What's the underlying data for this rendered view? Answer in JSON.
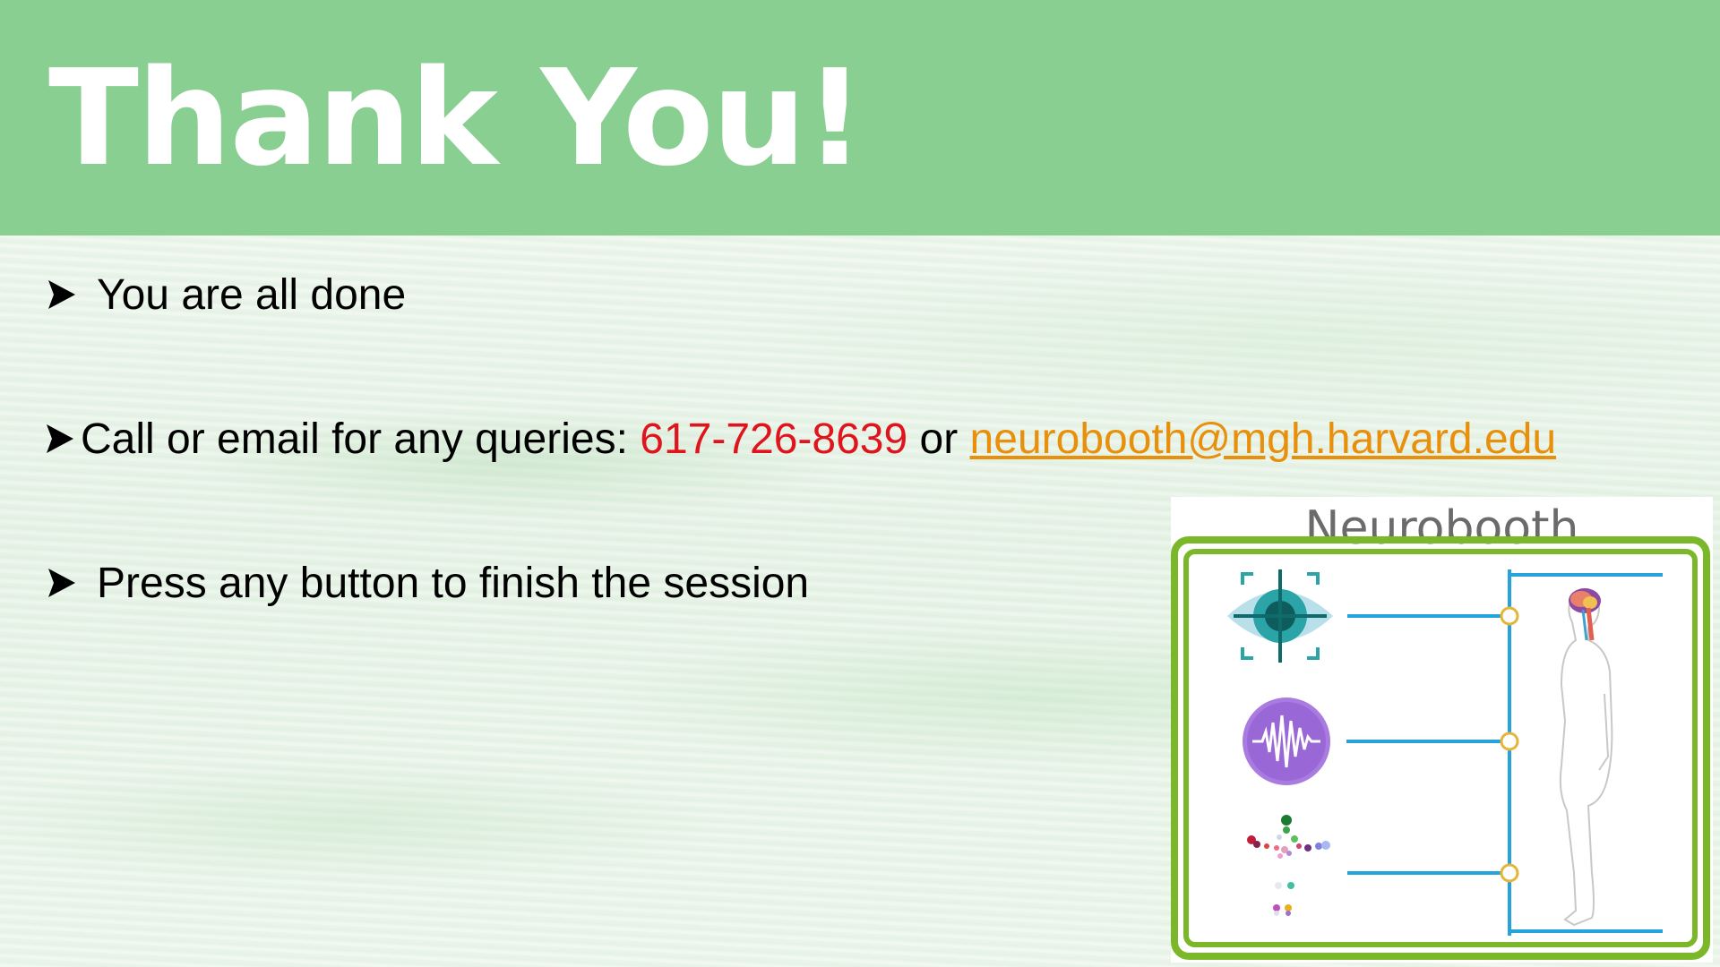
{
  "slide": {
    "title": "Thank You!",
    "bullets": [
      {
        "text": "You are all done"
      },
      {
        "prefix": "Call or email for any queries: ",
        "phone": "617-726-8639",
        "joiner": " or ",
        "email": "neurobooth@mgh.harvard.edu"
      },
      {
        "text": "Press any button to finish the session"
      }
    ]
  },
  "logo": {
    "title": "Neurobooth",
    "icons": [
      "eye-tracking-icon",
      "audio-waveform-icon",
      "motion-capture-markers-icon",
      "human-body-figure-icon"
    ]
  },
  "colors": {
    "header": "#88cf91",
    "title": "#ffffff",
    "phone": "#e0141c",
    "email": "#e8900c",
    "frame": "#7ab82a",
    "connector": "#27a3dc",
    "node": "#e5b43a"
  }
}
